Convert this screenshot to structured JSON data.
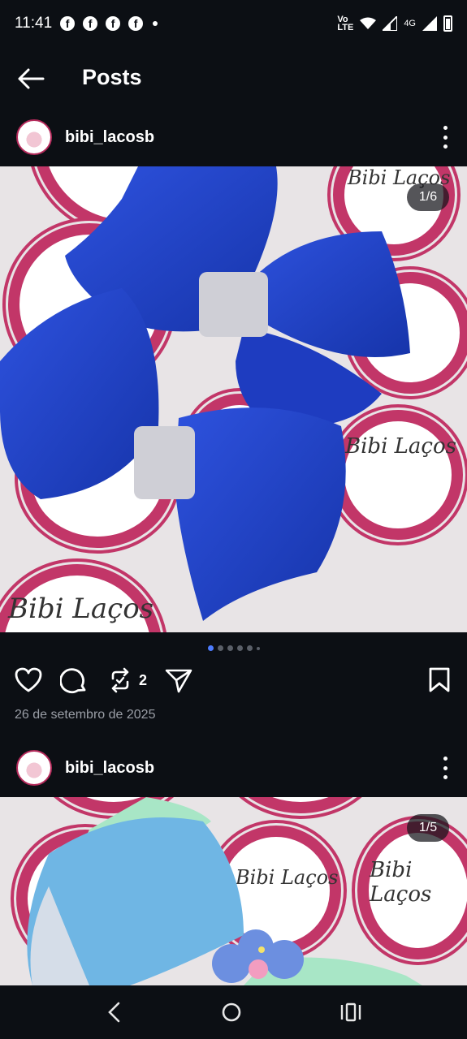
{
  "status": {
    "time": "11:41",
    "net_label": "Vo\nLTE",
    "signal_label": "4G"
  },
  "header": {
    "title": "Posts"
  },
  "posts": [
    {
      "username": "bibi_lacosb",
      "counter": "1/6",
      "sticker_text": "Bibi Laços",
      "repost_count": "2",
      "date": "26 de setembro de 2025",
      "carousel_total": 6,
      "carousel_index": 1
    },
    {
      "username": "bibi_lacosb",
      "counter": "1/5",
      "sticker_text": "Bibi Laços"
    }
  ],
  "colors": {
    "bow_blue": "#1f3fc2",
    "sticker_pink": "#c23668",
    "active_dot": "#4d7cff"
  },
  "icons": [
    "back-arrow-icon",
    "more-icon",
    "heart-icon",
    "comment-icon",
    "repost-icon",
    "share-icon",
    "bookmark-icon",
    "nav-back-icon",
    "nav-home-icon",
    "nav-recents-icon"
  ]
}
